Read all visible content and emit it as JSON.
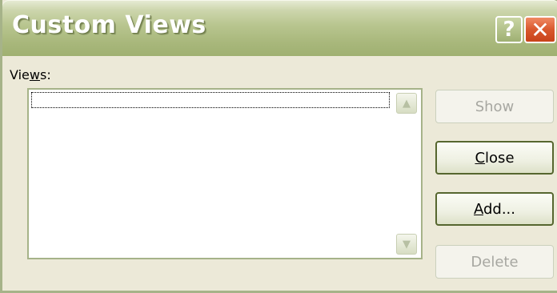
{
  "window": {
    "title": "Custom Views",
    "help_glyph": "?",
    "close_glyph": "✕"
  },
  "views": {
    "label_prefix": "Vie",
    "label_mnemonic": "w",
    "label_suffix": "s:",
    "items": []
  },
  "scrollbar": {
    "up_glyph": "▲",
    "down_glyph": "▼"
  },
  "buttons": {
    "show": {
      "label": "Show",
      "enabled": false
    },
    "close": {
      "mnemonic": "C",
      "rest": "lose",
      "enabled": true
    },
    "add": {
      "mnemonic": "A",
      "rest": "dd...",
      "enabled": true
    },
    "delete": {
      "label": "Delete",
      "enabled": false
    }
  },
  "colors": {
    "titlebar": "#a9b87c",
    "close_button": "#d9582d",
    "dialog_background": "#ece9d8",
    "button_border": "#56662f"
  }
}
